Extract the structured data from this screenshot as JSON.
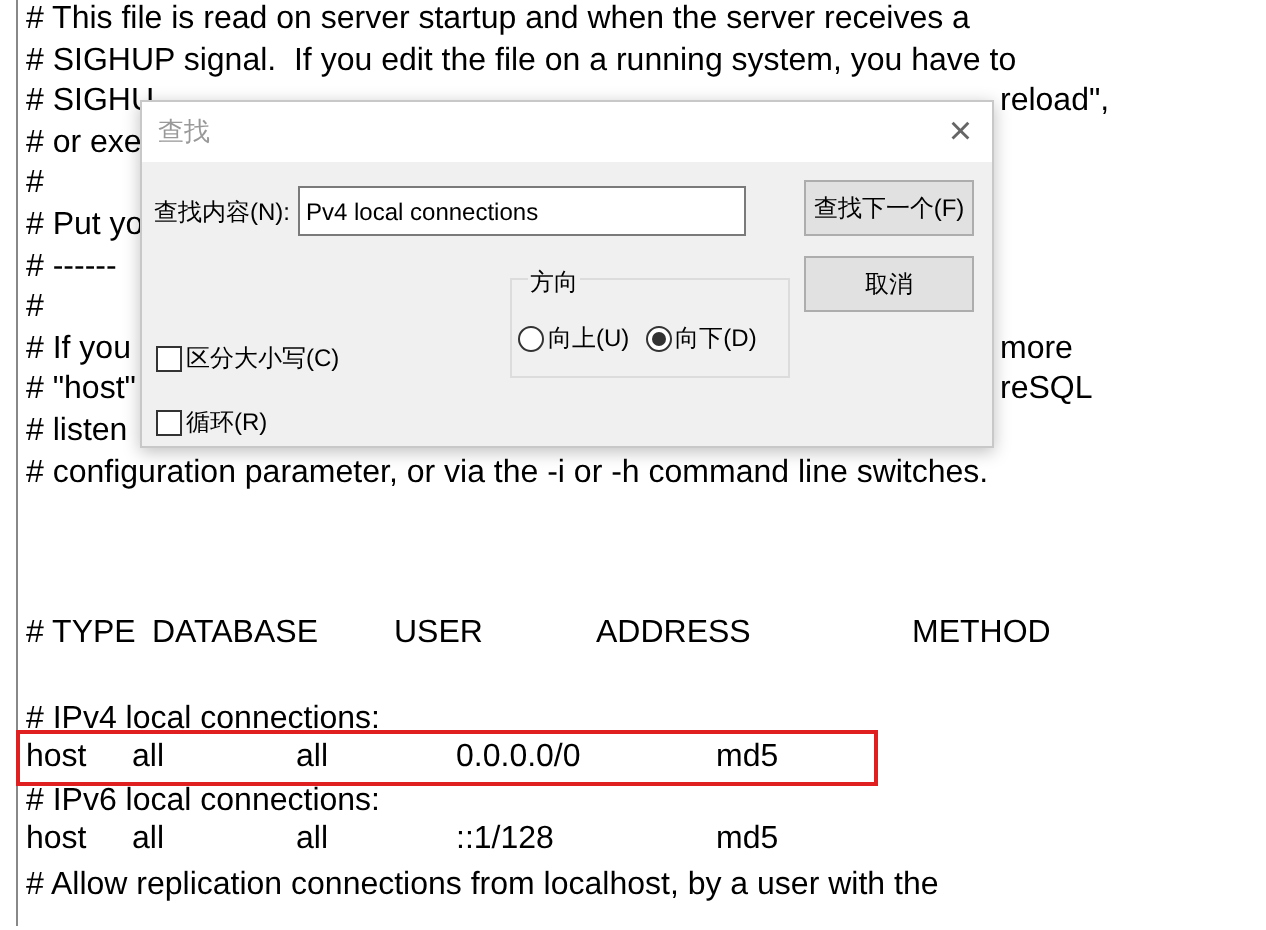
{
  "editor": {
    "lines": [
      {
        "kind": "text",
        "left": "# This file is read on server startup and when the server receives a"
      },
      {
        "kind": "text",
        "left": "# SIGHUP signal.  If you edit the file on a running system, you have to"
      },
      {
        "kind": "text",
        "left": "# SIGHU",
        "right": "reload\","
      },
      {
        "kind": "text",
        "left": "# or exe"
      },
      {
        "kind": "text",
        "left": "#"
      },
      {
        "kind": "text",
        "left": "# Put yo"
      },
      {
        "kind": "text",
        "left": "# ------"
      },
      {
        "kind": "text",
        "left": "#"
      },
      {
        "kind": "text",
        "left": "# If you",
        "right": "more"
      },
      {
        "kind": "text",
        "left": "# \"host\"",
        "right": "reSQL"
      },
      {
        "kind": "text",
        "left": "# listen"
      },
      {
        "kind": "text",
        "left": "# configuration parameter, or via the -i or -h command line switches."
      },
      {
        "kind": "blank"
      },
      {
        "kind": "blank"
      },
      {
        "kind": "blank"
      },
      {
        "kind": "header",
        "cells": [
          "# TYPE",
          "DATABASE",
          "USER",
          "ADDRESS",
          "METHOD"
        ]
      },
      {
        "kind": "blank"
      },
      {
        "kind": "text",
        "left": "# IPv4 local connections:"
      },
      {
        "kind": "entry",
        "highlighted": true,
        "cells": [
          "host",
          "all",
          "all",
          "0.0.0.0/0",
          "md5"
        ]
      },
      {
        "kind": "text",
        "left": "# IPv6 local connections:"
      },
      {
        "kind": "entry",
        "highlighted": false,
        "cells": [
          "host",
          "all",
          "all",
          "::1/128",
          "md5"
        ]
      },
      {
        "kind": "text",
        "left": "# Allow replication connections from localhost, by a user with the"
      }
    ]
  },
  "dialog": {
    "title": "查找",
    "close": "×",
    "find_label": "查找内容(N):",
    "find_value": "Pv4 local connections",
    "buttons": [
      "查找下一个(F)",
      "取消"
    ],
    "direction": {
      "label": "方向",
      "options": [
        {
          "label": "向上(U)",
          "selected": false
        },
        {
          "label": "向下(D)",
          "selected": true
        }
      ]
    },
    "checkboxes": [
      {
        "label": "区分大小写(C)",
        "checked": false
      },
      {
        "label": "循环(R)",
        "checked": false
      }
    ]
  }
}
